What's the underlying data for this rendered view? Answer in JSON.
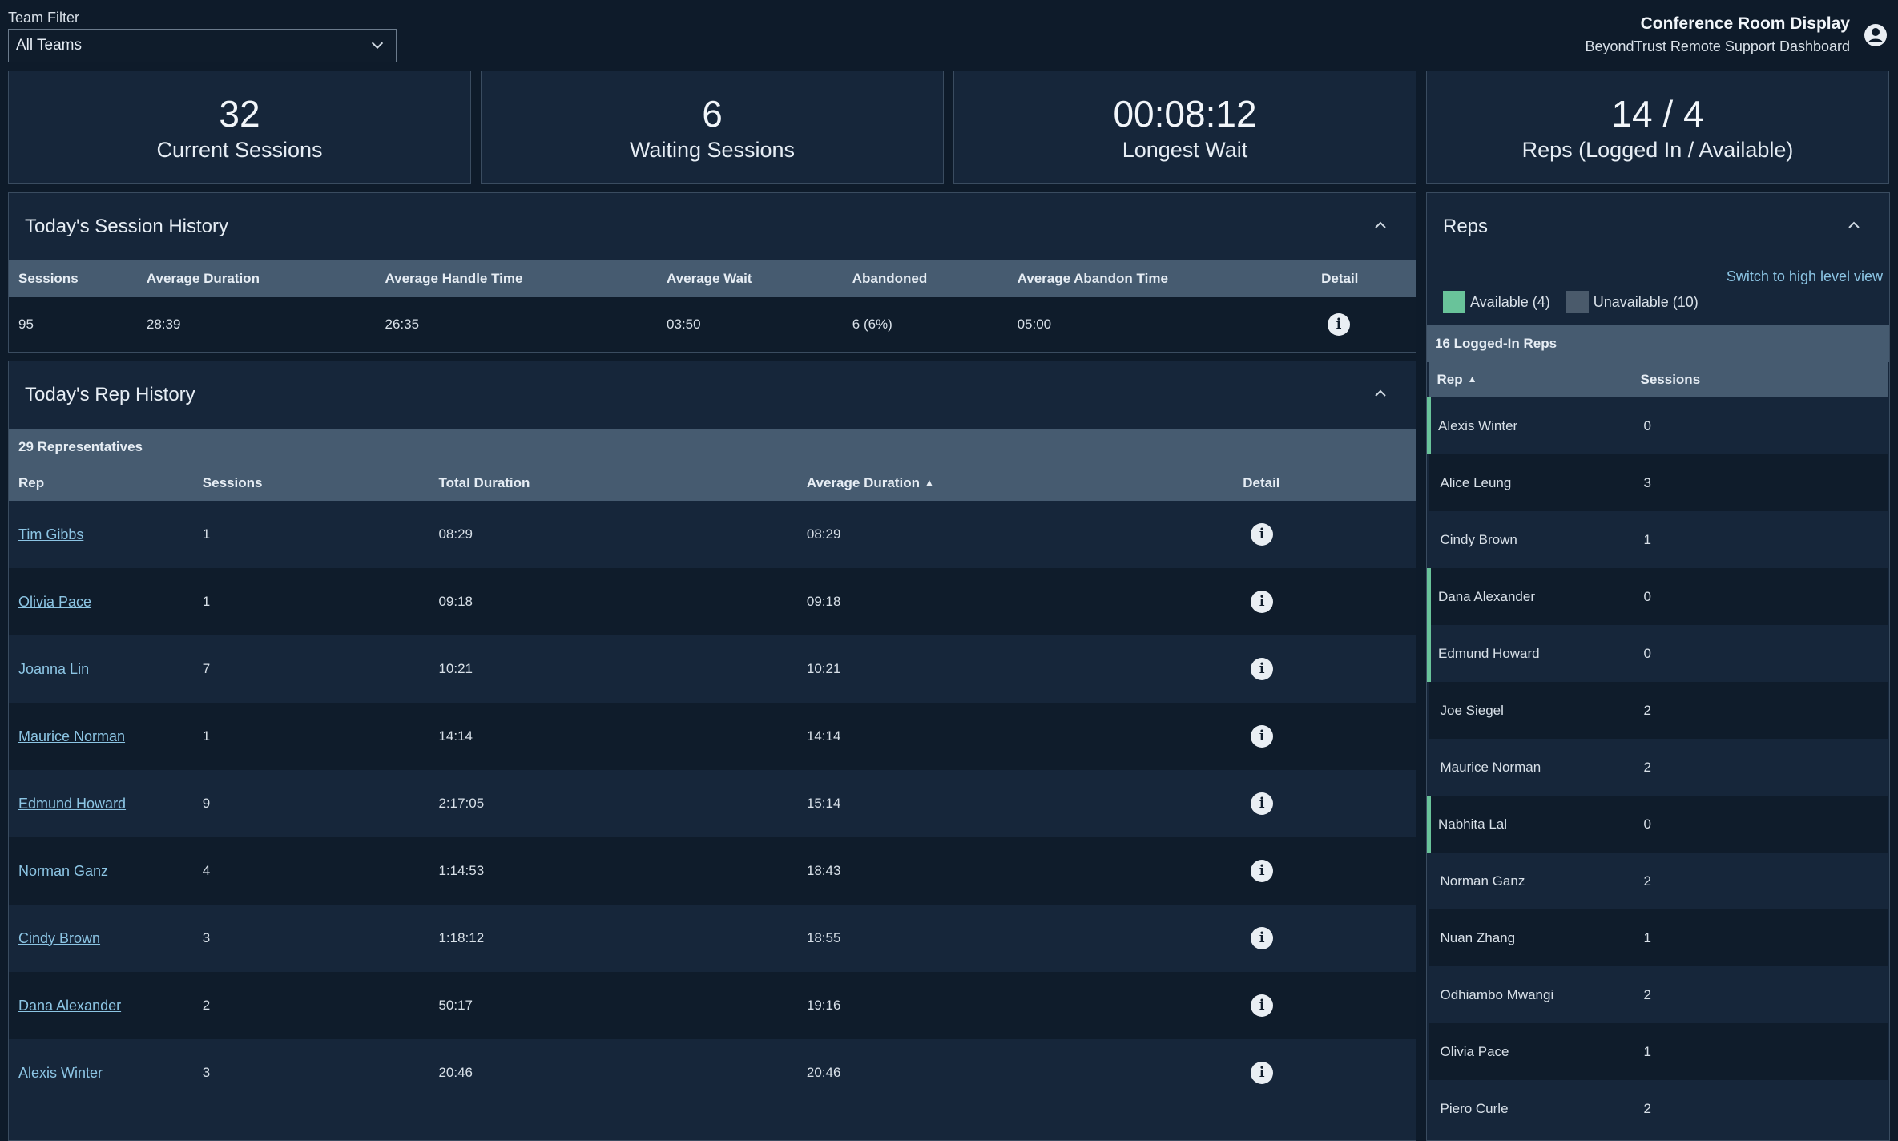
{
  "filter": {
    "label": "Team Filter",
    "value": "All Teams"
  },
  "brand": {
    "title": "Conference Room Display",
    "subtitle": "BeyondTrust Remote Support Dashboard"
  },
  "stats": [
    {
      "value": "32",
      "label": "Current Sessions"
    },
    {
      "value": "6",
      "label": "Waiting Sessions"
    },
    {
      "value": "00:08:12",
      "label": "Longest Wait"
    },
    {
      "value": "14 / 4",
      "label": "Reps (Logged In / Available)"
    }
  ],
  "session_history": {
    "title": "Today's Session History",
    "columns": [
      "Sessions",
      "Average Duration",
      "Average Handle Time",
      "Average Wait",
      "Abandoned",
      "Average Abandon Time",
      "Detail"
    ],
    "row": [
      "95",
      "28:39",
      "26:35",
      "03:50",
      "6 (6%)",
      "05:00"
    ]
  },
  "rep_history": {
    "title": "Today's Rep History",
    "count_label": "29 Representatives",
    "columns": [
      "Rep",
      "Sessions",
      "Total Duration",
      "Average Duration",
      "Detail"
    ],
    "rows": [
      {
        "rep": "Tim Gibbs",
        "sessions": "1",
        "total": "08:29",
        "avg": "08:29"
      },
      {
        "rep": "Olivia Pace",
        "sessions": "1",
        "total": "09:18",
        "avg": "09:18"
      },
      {
        "rep": "Joanna Lin",
        "sessions": "7",
        "total": "10:21",
        "avg": "10:21"
      },
      {
        "rep": "Maurice Norman",
        "sessions": "1",
        "total": "14:14",
        "avg": "14:14"
      },
      {
        "rep": "Edmund Howard",
        "sessions": "9",
        "total": "2:17:05",
        "avg": "15:14"
      },
      {
        "rep": "Norman Ganz",
        "sessions": "4",
        "total": "1:14:53",
        "avg": "18:43"
      },
      {
        "rep": "Cindy Brown",
        "sessions": "3",
        "total": "1:18:12",
        "avg": "18:55"
      },
      {
        "rep": "Dana Alexander",
        "sessions": "2",
        "total": "50:17",
        "avg": "19:16"
      },
      {
        "rep": "Alexis Winter",
        "sessions": "3",
        "total": "20:46",
        "avg": "20:46"
      }
    ]
  },
  "reps_panel": {
    "title": "Reps",
    "switch_link": "Switch to high level view",
    "legend_available": "Available (4)",
    "legend_unavailable": "Unavailable (10)",
    "count_label": "16 Logged-In Reps",
    "columns": [
      "Rep",
      "Sessions"
    ],
    "colors": {
      "available": "#69c39a",
      "unavailable": "#4a5a6b"
    },
    "rows": [
      {
        "rep": "Alexis Winter",
        "sessions": "0",
        "available": true
      },
      {
        "rep": "Alice Leung",
        "sessions": "3",
        "available": false
      },
      {
        "rep": "Cindy Brown",
        "sessions": "1",
        "available": false
      },
      {
        "rep": "Dana Alexander",
        "sessions": "0",
        "available": true
      },
      {
        "rep": "Edmund Howard",
        "sessions": "0",
        "available": true
      },
      {
        "rep": "Joe Siegel",
        "sessions": "2",
        "available": false
      },
      {
        "rep": "Maurice Norman",
        "sessions": "2",
        "available": false
      },
      {
        "rep": "Nabhita Lal",
        "sessions": "0",
        "available": true
      },
      {
        "rep": "Norman Ganz",
        "sessions": "2",
        "available": false
      },
      {
        "rep": "Nuan Zhang",
        "sessions": "1",
        "available": false
      },
      {
        "rep": "Odhiambo Mwangi",
        "sessions": "2",
        "available": false
      },
      {
        "rep": "Olivia Pace",
        "sessions": "1",
        "available": false
      },
      {
        "rep": "Piero Curle",
        "sessions": "2",
        "available": false
      }
    ]
  }
}
